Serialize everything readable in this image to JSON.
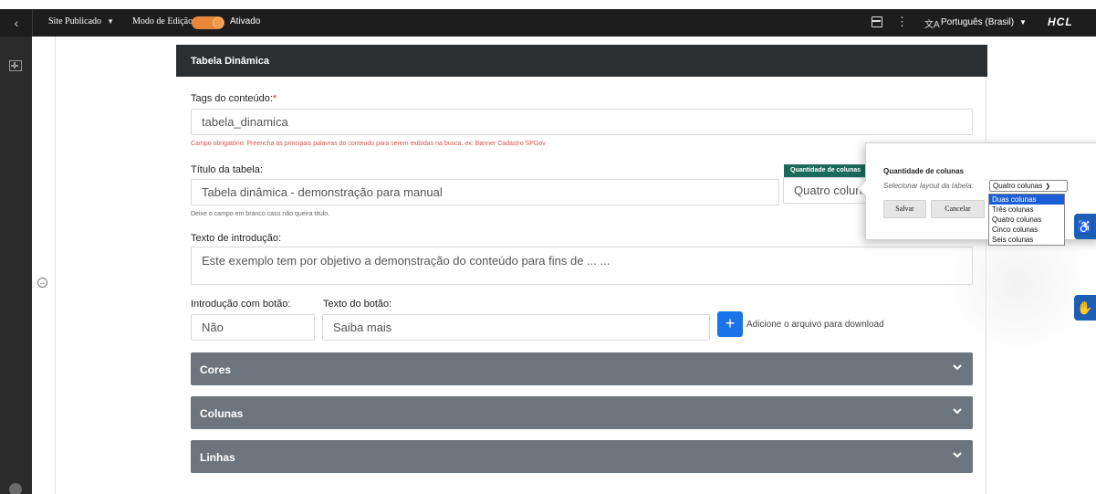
{
  "topbar": {
    "back_icon": "chevron-left-icon",
    "site_label": "Site Publicado",
    "edit_mode_label": "Modo de Edição:",
    "edit_mode_state": "Ativado",
    "toggle_on": true,
    "language": "Português (Brasil)",
    "logo": "HCL",
    "accent_color": "#e8873a"
  },
  "card": {
    "title": "Tabela Dinâmica"
  },
  "form": {
    "tags_label": "Tags do conteúdo:",
    "tags_required_mark": "*",
    "tags_value": "tabela_dinamica",
    "tags_help": "Campo obrigatório: Preencha as principais palavras do conteudo para serem exibidas na busca. ex: Banner Cadastro SPGov",
    "table_title_label": "Título da tabela:",
    "table_title_value": "Tabela dinâmica - demonstração para manual",
    "table_title_help": "Deixe o campo em branco caso não queira titulo.",
    "qty_tag": "Quantidade de colunas",
    "qty_value": "Quatro colunas",
    "intro_label": "Texto de introdução:",
    "intro_value": "Este exemplo tem por objetivo a demonstração do conteúdo para fins de ... ...",
    "intro_button_label": "Introdução com botão:",
    "intro_button_value": "Não",
    "button_text_label": "Texto do botão:",
    "button_text_value": "Saiba mais",
    "add_file_symbol": "+",
    "add_file_text": "Adicione o arquivo para download"
  },
  "accordions": [
    {
      "title": "Cores"
    },
    {
      "title": "Colunas"
    },
    {
      "title": "Linhas"
    }
  ],
  "popup": {
    "title": "Quantidade de colunas",
    "subtitle": "Selecionar layout da tabela:",
    "selected": "Quatro colunas",
    "save": "Salvar",
    "cancel": "Cancelar",
    "options": [
      "Duas colunas",
      "Três colunas",
      "Quatro colunas",
      "Cinco colunas",
      "Seis colunas"
    ],
    "highlighted_option": "Duas colunas"
  }
}
